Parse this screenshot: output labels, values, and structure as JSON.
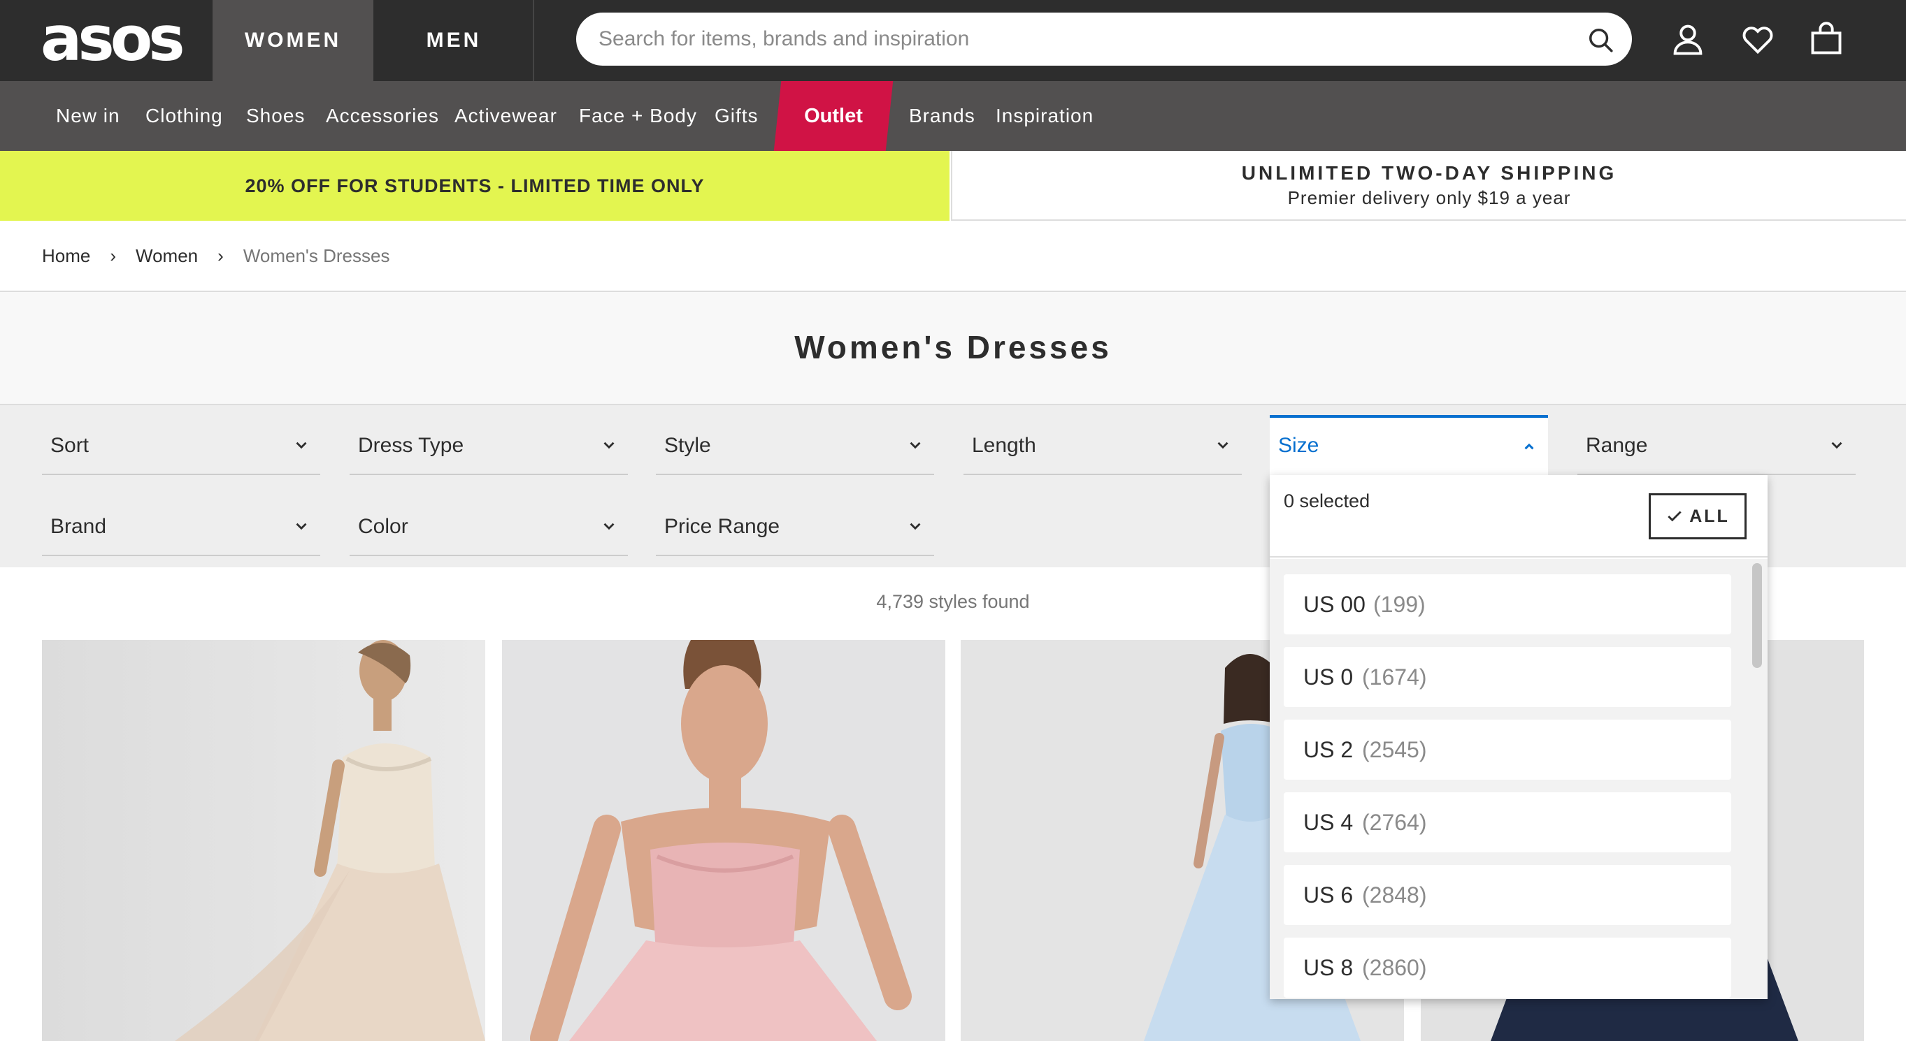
{
  "header": {
    "logo": "asos",
    "tabs": [
      {
        "label": "WOMEN",
        "active": true
      },
      {
        "label": "MEN",
        "active": false
      }
    ],
    "search_placeholder": "Search for items, brands and inspiration",
    "icons": [
      "search-icon",
      "account-icon",
      "heart-icon",
      "bag-icon"
    ]
  },
  "nav": {
    "items": [
      "New in",
      "Clothing",
      "Shoes",
      "Accessories",
      "Activewear",
      "Face + Body",
      "Gifts",
      "Outlet",
      "Brands",
      "Inspiration"
    ],
    "highlight_color": "#d01345"
  },
  "promo": {
    "left": "20% OFF FOR STUDENTS - LIMITED TIME ONLY",
    "left_color": "#e3f550",
    "right_title": "UNLIMITED TWO-DAY SHIPPING",
    "right_subtitle": "Premier delivery only $19 a year"
  },
  "breadcrumb": [
    "Home",
    "Women",
    "Women's Dresses"
  ],
  "page_title": "Women's Dresses",
  "filters": {
    "row1": [
      "Sort",
      "Dress Type",
      "Style",
      "Length",
      "Size",
      "Range"
    ],
    "row2": [
      "Brand",
      "Color",
      "Price Range"
    ],
    "open": "Size",
    "accent_color": "#0770cf"
  },
  "results": {
    "count_text": "4,739 styles found"
  },
  "size_dropdown": {
    "selected_text": "0 selected",
    "all_label": "ALL",
    "options": [
      {
        "size": "US 00",
        "count": "(199)"
      },
      {
        "size": "US 0",
        "count": "(1674)"
      },
      {
        "size": "US 2",
        "count": "(2545)"
      },
      {
        "size": "US 4",
        "count": "(2764)"
      },
      {
        "size": "US 6",
        "count": "(2848)"
      },
      {
        "size": "US 8",
        "count": "(2860)"
      }
    ]
  }
}
